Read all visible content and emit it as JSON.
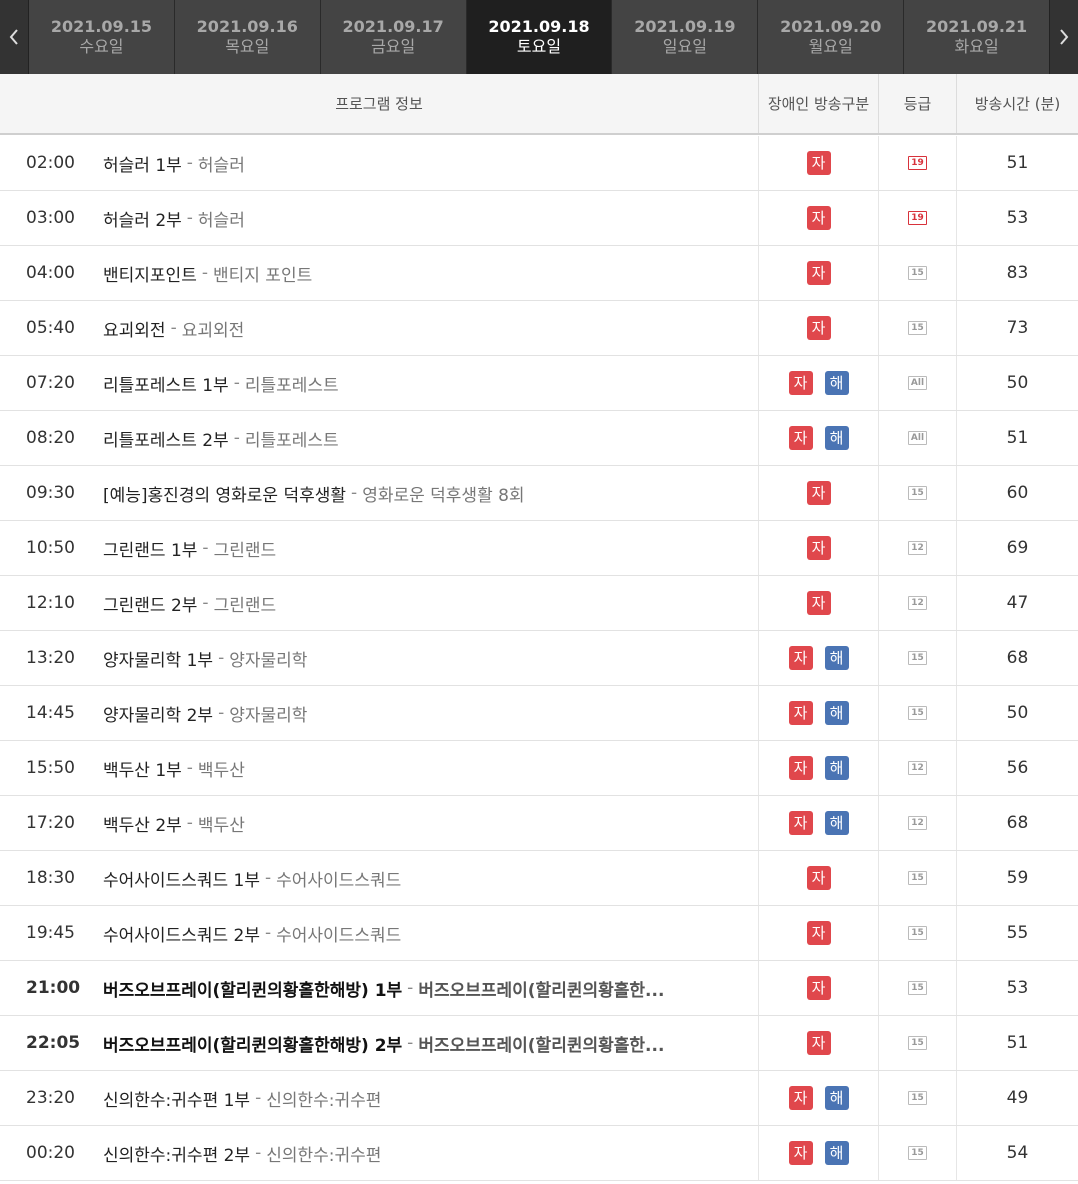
{
  "nav": {
    "prev_icon": "chevron-left-icon",
    "next_icon": "chevron-right-icon"
  },
  "dates": [
    {
      "date": "2021.09.15",
      "weekday": "수요일",
      "active": false
    },
    {
      "date": "2021.09.16",
      "weekday": "목요일",
      "active": false
    },
    {
      "date": "2021.09.17",
      "weekday": "금요일",
      "active": false
    },
    {
      "date": "2021.09.18",
      "weekday": "토요일",
      "active": true
    },
    {
      "date": "2021.09.19",
      "weekday": "일요일",
      "active": false
    },
    {
      "date": "2021.09.20",
      "weekday": "월요일",
      "active": false
    },
    {
      "date": "2021.09.21",
      "weekday": "화요일",
      "active": false
    }
  ],
  "header": {
    "program_info": "프로그램 정보",
    "barrier_free": "장애인 방송구분",
    "grade": "등급",
    "duration": "방송시간 (분)"
  },
  "badges": {
    "subtitle": "자",
    "description": "해"
  },
  "colors": {
    "subtitle_badge": "#e0474c",
    "description_badge": "#4a74b4",
    "rating_19": "#d8323b",
    "active_tab": "#1f1f1f"
  },
  "rows": [
    {
      "time": "02:00",
      "title": "허슬러 1부",
      "subtitle": "허슬러",
      "sub": true,
      "desc": false,
      "rating": "19",
      "duration": "51",
      "bold": false
    },
    {
      "time": "03:00",
      "title": "허슬러 2부",
      "subtitle": "허슬러",
      "sub": true,
      "desc": false,
      "rating": "19",
      "duration": "53",
      "bold": false
    },
    {
      "time": "04:00",
      "title": "밴티지포인트",
      "subtitle": "밴티지 포인트",
      "sub": true,
      "desc": false,
      "rating": "15",
      "duration": "83",
      "bold": false
    },
    {
      "time": "05:40",
      "title": "요괴외전",
      "subtitle": "요괴외전",
      "sub": true,
      "desc": false,
      "rating": "15",
      "duration": "73",
      "bold": false
    },
    {
      "time": "07:20",
      "title": "리틀포레스트 1부",
      "subtitle": "리틀포레스트",
      "sub": true,
      "desc": true,
      "rating": "All",
      "duration": "50",
      "bold": false
    },
    {
      "time": "08:20",
      "title": "리틀포레스트 2부",
      "subtitle": "리틀포레스트",
      "sub": true,
      "desc": true,
      "rating": "All",
      "duration": "51",
      "bold": false
    },
    {
      "time": "09:30",
      "title": "[예능]홍진경의 영화로운 덕후생활",
      "subtitle": "영화로운 덕후생활 8회",
      "sub": true,
      "desc": false,
      "rating": "15",
      "duration": "60",
      "bold": false
    },
    {
      "time": "10:50",
      "title": "그린랜드 1부",
      "subtitle": "그린랜드",
      "sub": true,
      "desc": false,
      "rating": "12",
      "duration": "69",
      "bold": false
    },
    {
      "time": "12:10",
      "title": "그린랜드 2부",
      "subtitle": "그린랜드",
      "sub": true,
      "desc": false,
      "rating": "12",
      "duration": "47",
      "bold": false
    },
    {
      "time": "13:20",
      "title": "양자물리학 1부",
      "subtitle": "양자물리학",
      "sub": true,
      "desc": true,
      "rating": "15",
      "duration": "68",
      "bold": false
    },
    {
      "time": "14:45",
      "title": "양자물리학 2부",
      "subtitle": "양자물리학",
      "sub": true,
      "desc": true,
      "rating": "15",
      "duration": "50",
      "bold": false
    },
    {
      "time": "15:50",
      "title": "백두산 1부",
      "subtitle": "백두산",
      "sub": true,
      "desc": true,
      "rating": "12",
      "duration": "56",
      "bold": false
    },
    {
      "time": "17:20",
      "title": "백두산 2부",
      "subtitle": "백두산",
      "sub": true,
      "desc": true,
      "rating": "12",
      "duration": "68",
      "bold": false
    },
    {
      "time": "18:30",
      "title": "수어사이드스쿼드 1부",
      "subtitle": "수어사이드스쿼드",
      "sub": true,
      "desc": false,
      "rating": "15",
      "duration": "59",
      "bold": false
    },
    {
      "time": "19:45",
      "title": "수어사이드스쿼드 2부",
      "subtitle": "수어사이드스쿼드",
      "sub": true,
      "desc": false,
      "rating": "15",
      "duration": "55",
      "bold": false
    },
    {
      "time": "21:00",
      "title": "버즈오브프레이(할리퀸의황홀한해방) 1부",
      "subtitle": "버즈오브프레이(할리퀸의황홀한...",
      "sub": true,
      "desc": false,
      "rating": "15",
      "duration": "53",
      "bold": true
    },
    {
      "time": "22:05",
      "title": "버즈오브프레이(할리퀸의황홀한해방) 2부",
      "subtitle": "버즈오브프레이(할리퀸의황홀한...",
      "sub": true,
      "desc": false,
      "rating": "15",
      "duration": "51",
      "bold": true
    },
    {
      "time": "23:20",
      "title": "신의한수:귀수편 1부",
      "subtitle": "신의한수:귀수편",
      "sub": true,
      "desc": true,
      "rating": "15",
      "duration": "49",
      "bold": false
    },
    {
      "time": "00:20",
      "title": "신의한수:귀수편 2부",
      "subtitle": "신의한수:귀수편",
      "sub": true,
      "desc": true,
      "rating": "15",
      "duration": "54",
      "bold": false
    }
  ]
}
